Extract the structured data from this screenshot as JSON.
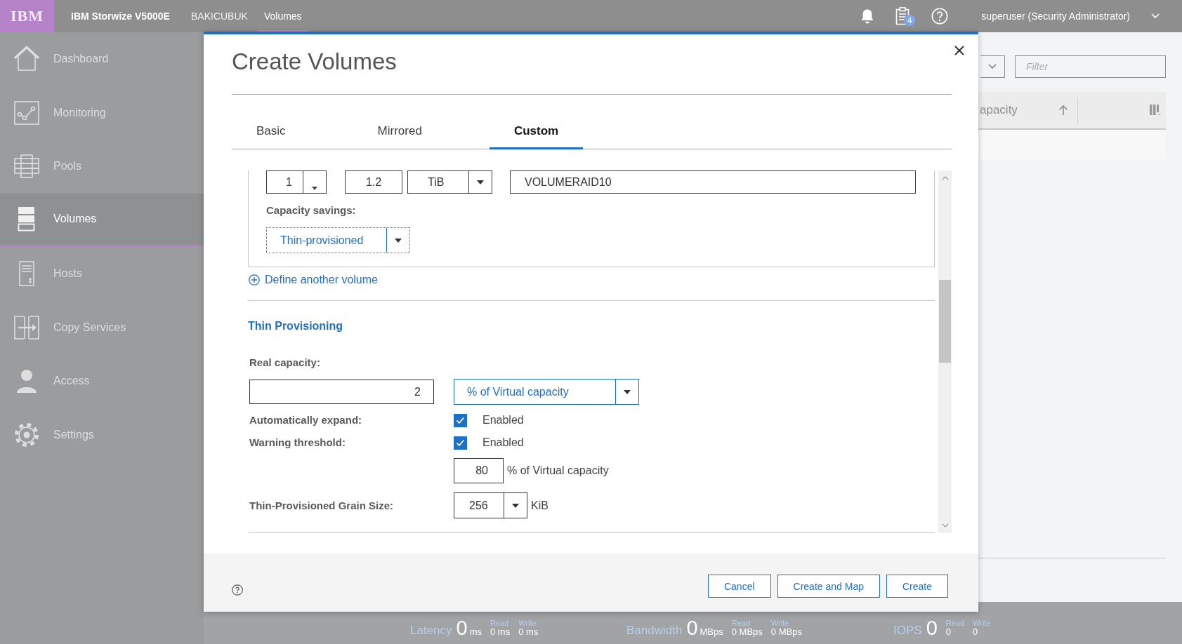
{
  "top_bar": {
    "logo": "IBM",
    "product": "IBM Storwize V5000E",
    "nav": [
      {
        "label": "BAKICUBUK",
        "selected": false
      },
      {
        "label": "Volumes",
        "selected": true
      }
    ],
    "tasks_badge": "4",
    "user": "superuser (Security Administrator)"
  },
  "sidebar": {
    "items": [
      {
        "label": "Dashboard",
        "selected": false
      },
      {
        "label": "Monitoring",
        "selected": false
      },
      {
        "label": "Pools",
        "selected": false
      },
      {
        "label": "Volumes",
        "selected": true
      },
      {
        "label": "Hosts",
        "selected": false
      },
      {
        "label": "Copy Services",
        "selected": false
      },
      {
        "label": "Access",
        "selected": false
      },
      {
        "label": "Settings",
        "selected": false
      }
    ]
  },
  "volumes_page": {
    "filter": {
      "placeholder": "Filter"
    },
    "table": {
      "columns": [
        {
          "label": "apacity"
        }
      ]
    }
  },
  "dialog": {
    "title": "Create Volumes",
    "tabs": [
      {
        "label": "Basic",
        "selected": false
      },
      {
        "label": "Mirrored",
        "selected": false
      },
      {
        "label": "Custom",
        "selected": true
      }
    ],
    "volume": {
      "quantity": "1",
      "capacity": "1.2",
      "unit": "TiB",
      "name": "VOLUMERAID10",
      "capacity_savings_label": "Capacity savings:",
      "capacity_savings": "Thin-provisioned"
    },
    "define_link": "Define another volume",
    "thin_provisioning": {
      "heading": "Thin Provisioning",
      "real_capacity": {
        "label": "Real capacity:",
        "value": "2",
        "unit": "% of Virtual capacity"
      },
      "auto_expand": {
        "label": "Automatically expand:",
        "checked": true,
        "text": "Enabled"
      },
      "warning_threshold": {
        "label": "Warning threshold:",
        "checked": true,
        "text": "Enabled",
        "value": "80",
        "unit": "% of Virtual capacity"
      },
      "grain_size": {
        "label": "Thin-Provisioned Grain Size:",
        "value": "256",
        "unit": "KiB"
      }
    },
    "buttons": [
      "Cancel",
      "Create and Map",
      "Create"
    ]
  },
  "status_bar": {
    "metrics": [
      {
        "label": "Latency",
        "value": "0",
        "unit": "ms",
        "read_label": "Read",
        "read": "0 ms",
        "write_label": "Write",
        "write": "0 ms"
      },
      {
        "label": "Bandwidth",
        "value": "0",
        "unit": "MBps",
        "read_label": "Read",
        "read": "0 MBps",
        "write_label": "Write",
        "write": "0 MBps"
      },
      {
        "label": "IOPS",
        "value": "0",
        "read_label": "Read",
        "read": "0",
        "write_label": "Write",
        "write": "0"
      }
    ]
  }
}
